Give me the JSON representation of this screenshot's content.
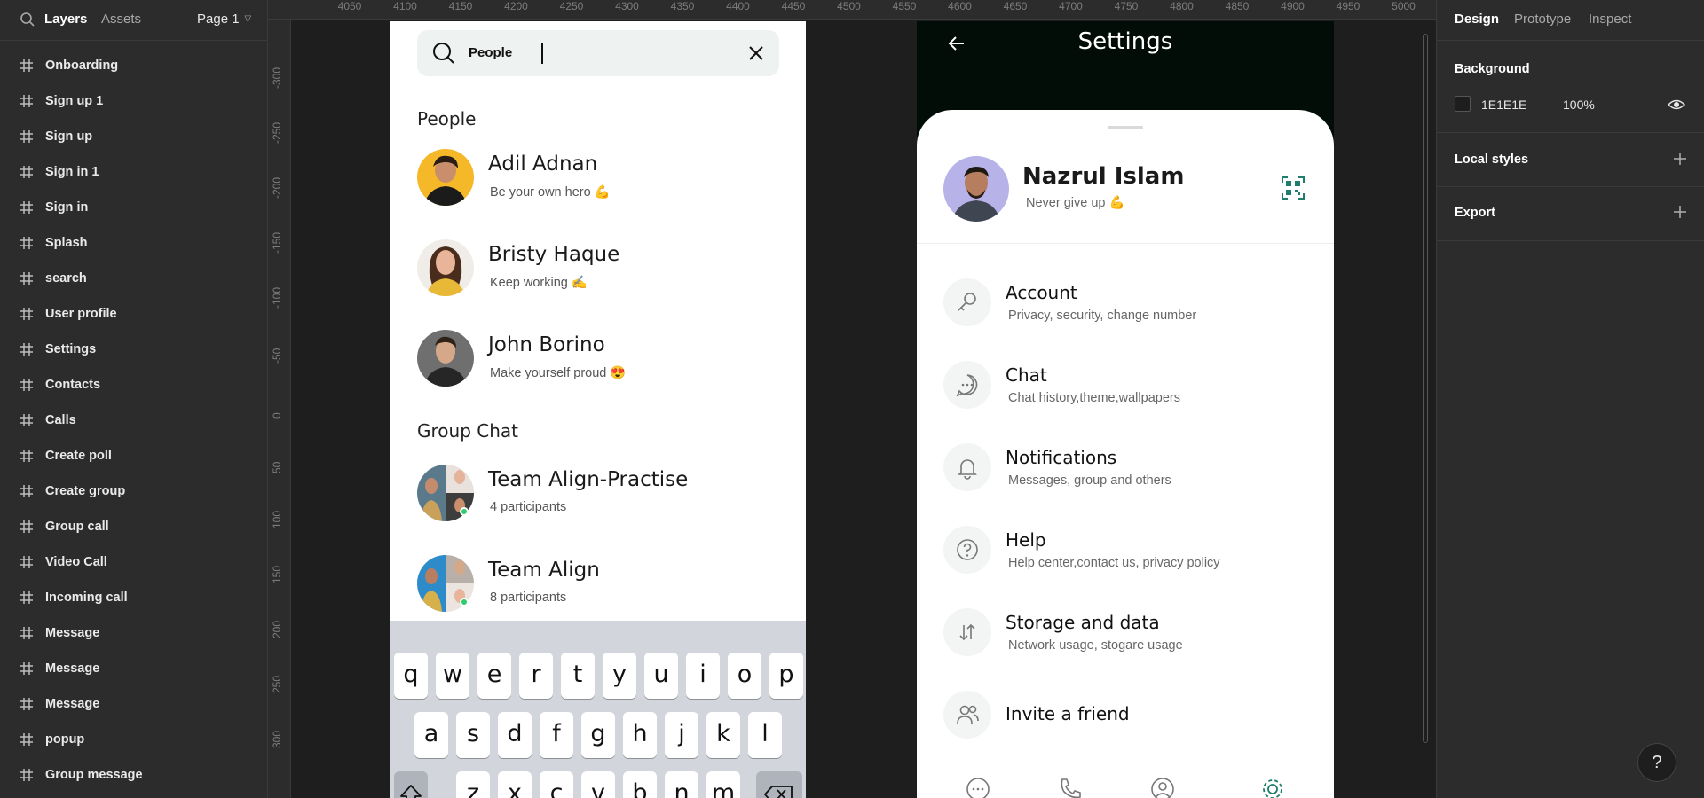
{
  "left_panel": {
    "tabs": {
      "layers": "Layers",
      "assets": "Assets"
    },
    "page": "Page 1",
    "layers": [
      "Onboarding",
      "Sign up 1",
      "Sign up",
      "Sign in 1",
      "Sign in",
      "Splash",
      "search",
      "User profile",
      "Settings",
      "Contacts",
      "Calls",
      "Create poll",
      "Create group",
      "Group call",
      "Video Call",
      "Incoming call",
      "Message",
      "Message",
      "Message",
      "popup",
      "Group message"
    ]
  },
  "rulers": {
    "top": [
      "4050",
      "4100",
      "4150",
      "4200",
      "4250",
      "4300",
      "4350",
      "4400",
      "4450",
      "4500",
      "4550",
      "4600",
      "4650",
      "4700",
      "4750",
      "4800",
      "4850",
      "4900",
      "4950",
      "5000"
    ],
    "left": [
      "-300",
      "-250",
      "-200",
      "-150",
      "-100",
      "-50",
      "0",
      "50",
      "100",
      "150",
      "200",
      "250",
      "300"
    ]
  },
  "search_screen": {
    "query": "People",
    "people_title": "People",
    "people": [
      {
        "name": "Adil Adnan",
        "status": "Be your own hero 💪"
      },
      {
        "name": "Bristy Haque",
        "status": "Keep working ✍"
      },
      {
        "name": "John Borino",
        "status": "Make yourself proud 😍"
      }
    ],
    "group_title": "Group Chat",
    "groups": [
      {
        "name": "Team Align-Practise",
        "status": "4 participants"
      },
      {
        "name": "Team Align",
        "status": "8 participants"
      }
    ],
    "keyboard": {
      "row1": [
        "q",
        "w",
        "e",
        "r",
        "t",
        "y",
        "u",
        "i",
        "o",
        "p"
      ],
      "row2": [
        "a",
        "s",
        "d",
        "f",
        "g",
        "h",
        "j",
        "k",
        "l"
      ],
      "row3": [
        "z",
        "x",
        "c",
        "v",
        "b",
        "n",
        "m"
      ]
    }
  },
  "settings_screen": {
    "title": "Settings",
    "profile": {
      "name": "Nazrul Islam",
      "status": "Never give up 💪"
    },
    "items": [
      {
        "title": "Account",
        "desc": "Privacy, security, change number",
        "icon": "key-icon"
      },
      {
        "title": "Chat",
        "desc": "Chat history,theme,wallpapers",
        "icon": "chat-icon"
      },
      {
        "title": "Notifications",
        "desc": "Messages, group and others",
        "icon": "bell-icon"
      },
      {
        "title": "Help",
        "desc": "Help center,contact us, privacy policy",
        "icon": "help-icon"
      },
      {
        "title": "Storage and data",
        "desc": "Network usage, stogare usage",
        "icon": "transfer-icon"
      },
      {
        "title": "Invite a friend",
        "desc": "",
        "icon": "invite-icon"
      }
    ]
  },
  "right_panel": {
    "tabs": {
      "design": "Design",
      "prototype": "Prototype",
      "inspect": "Inspect"
    },
    "background": {
      "title": "Background",
      "hex": "1E1E1E",
      "opacity": "100%"
    },
    "local_styles": "Local styles",
    "export": "Export",
    "help": "?"
  },
  "colors": {
    "accent": "#1e7d6b",
    "canvas": "#1e1e1e",
    "panel": "#2c2c2c",
    "settings_header": "#020d08"
  }
}
